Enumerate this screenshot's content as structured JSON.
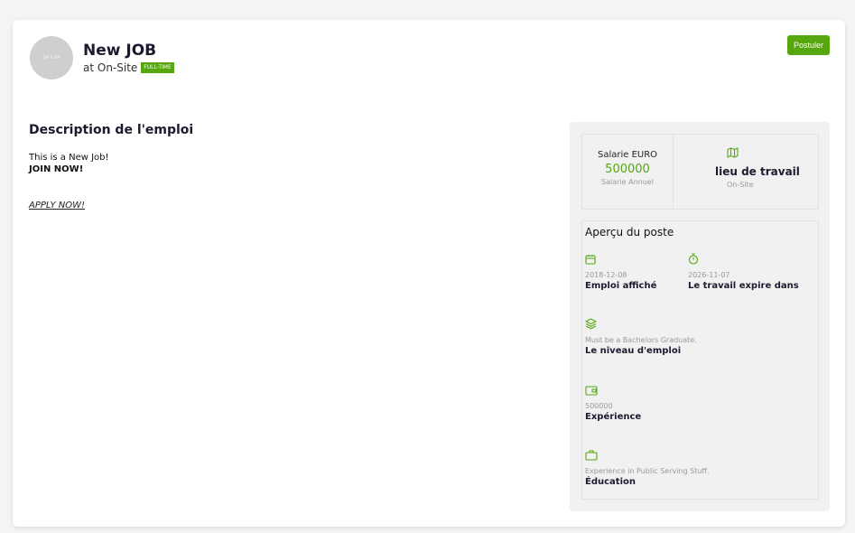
{
  "header": {
    "avatar_text": "84 x 84",
    "title": "New JOB",
    "location_text": "at On-Site",
    "job_type_badge": "FULL-TIME",
    "apply_button": "Postuler"
  },
  "description": {
    "heading": "Description de l'emploi",
    "line1": "This is a New Job!",
    "line2": "JOIN NOW!",
    "apply_link": "APPLY NOW!"
  },
  "salary": {
    "label": "Salarie EURO",
    "value": "500000",
    "period": "Salarie Annuel"
  },
  "workplace": {
    "label": "lieu de travail",
    "value": "On-Site",
    "icon": "map-icon"
  },
  "overview": {
    "title": "Aperçu du poste",
    "posted": {
      "value": "2018-12-08",
      "label": "Emploi affiché",
      "icon": "calendar-icon"
    },
    "expires": {
      "value": "2026-11-07",
      "label": "Le travail expire dans",
      "icon": "stopwatch-icon"
    },
    "level": {
      "value": "Must be a Bachelors Graduate.",
      "label": "Le niveau d'emploi",
      "icon": "layers-icon"
    },
    "experience": {
      "value": "500000",
      "label": "Expérience",
      "icon": "wallet-icon"
    },
    "education": {
      "value": "Experience in Public Serving Stuff.",
      "label": "Éducation",
      "icon": "briefcase-icon"
    }
  },
  "colors": {
    "accent": "#55a60f",
    "background": "#f4f4f6",
    "panel": "#f1f1f1"
  }
}
